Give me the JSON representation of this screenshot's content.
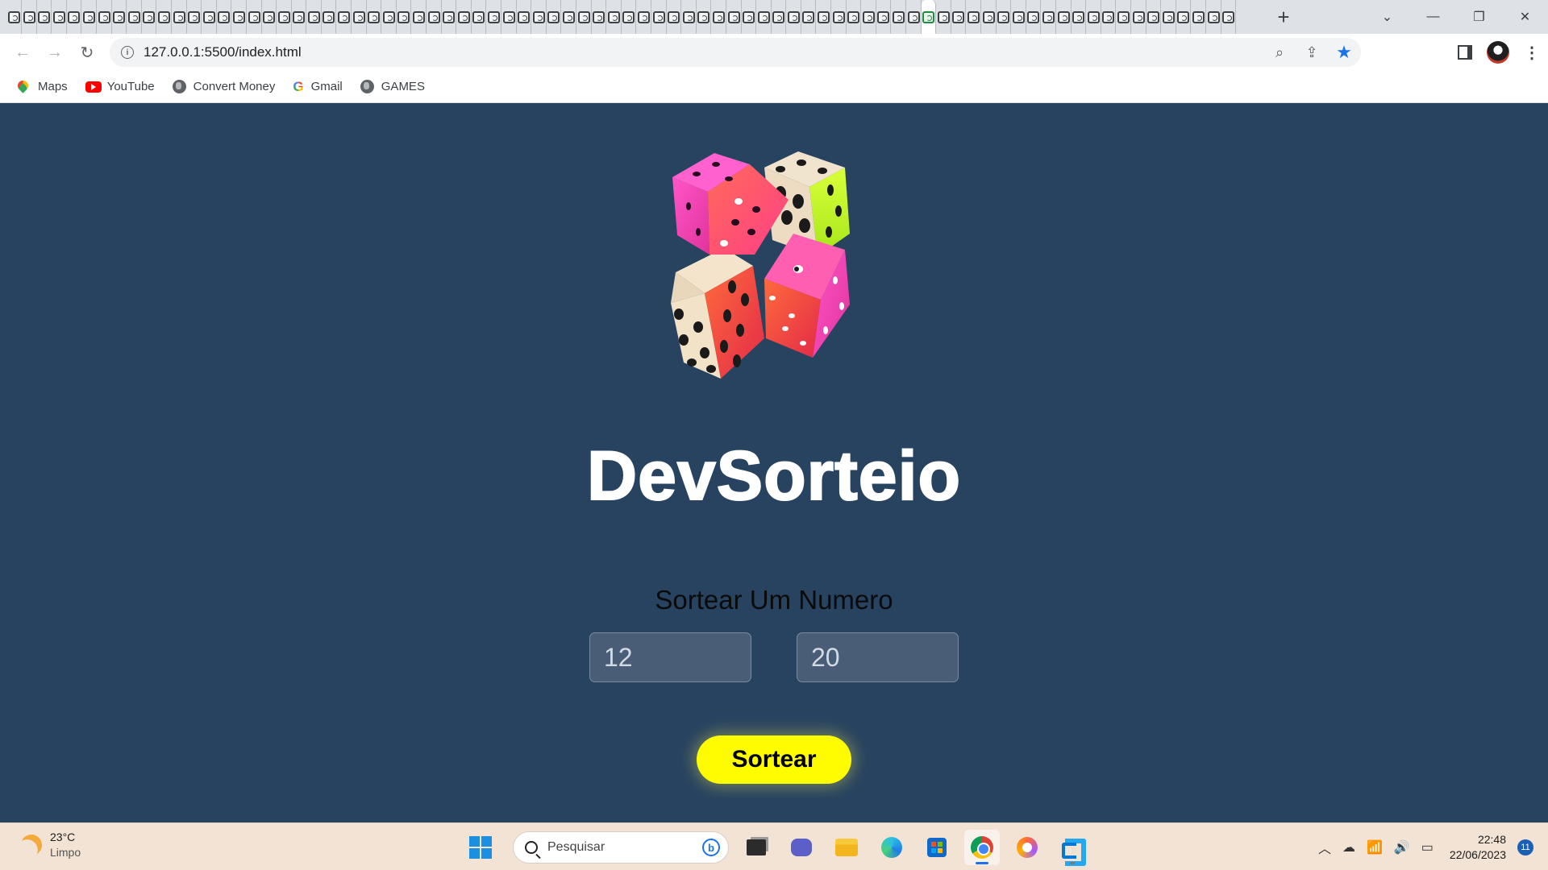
{
  "browser": {
    "tab_count": 82,
    "active_tab_index": 61,
    "new_tab_label": "+",
    "window_controls": {
      "list": "⌄",
      "minimize": "—",
      "restore": "❐",
      "close": "✕"
    },
    "url": "127.0.0.1:5500/index.html",
    "bookmarks": [
      {
        "label": "Maps",
        "icon": "maps-pin-icon"
      },
      {
        "label": "YouTube",
        "icon": "youtube-icon"
      },
      {
        "label": "Convert Money",
        "icon": "globe-icon"
      },
      {
        "label": "Gmail",
        "icon": "google-icon"
      },
      {
        "label": "GAMES",
        "icon": "globe-icon"
      }
    ],
    "accent_color": "#1a73e8"
  },
  "page": {
    "background_color": "#284360",
    "logo": "dice-logo",
    "title": "DevSorteio",
    "subtitle": "Sortear Um Numero",
    "min_input": {
      "value": "12"
    },
    "max_input": {
      "value": "20"
    },
    "draw_button": {
      "label": "Sortear",
      "color": "#fffc00"
    }
  },
  "taskbar": {
    "weather": {
      "temp": "23°C",
      "condition": "Limpo"
    },
    "search_placeholder": "Pesquisar",
    "apps": [
      "task-view",
      "teams-meet",
      "file-explorer",
      "edge",
      "microsoft-store",
      "chrome",
      "brave",
      "vscode"
    ],
    "active_app": "chrome",
    "clock": {
      "time": "22:48",
      "date": "22/06/2023"
    },
    "notification_count": "11"
  }
}
